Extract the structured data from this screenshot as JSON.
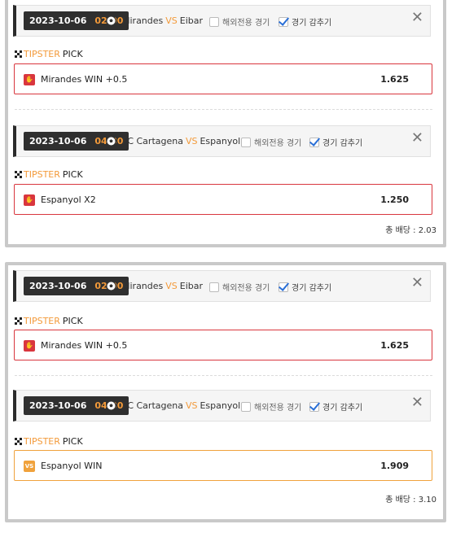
{
  "tipster": {
    "word1": "TIPSTER",
    "word2": "PICK"
  },
  "cards": [
    {
      "matches": [
        {
          "date": "2023-10-06",
          "time": "02:00",
          "home": "Mirandes",
          "vs": "VS",
          "away": "Eibar",
          "overseas_label": "해외전용 경기",
          "hide_label": "경기 감추기",
          "pick_label": "Mirandes WIN +0.5",
          "odds": "1.625",
          "pick_icon": "hand-icon"
        },
        {
          "date": "2023-10-06",
          "time": "04:30",
          "home": "FC Cartagena",
          "vs": "VS",
          "away": "Espanyol",
          "overseas_label": "해외전용 경기",
          "hide_label": "경기 감추기",
          "pick_label": "Espanyol X2",
          "odds": "1.250",
          "pick_icon": "hand-icon"
        }
      ],
      "total": "총 배당 : 2.03"
    },
    {
      "matches": [
        {
          "date": "2023-10-06",
          "time": "02:00",
          "home": "Mirandes",
          "vs": "VS",
          "away": "Eibar",
          "overseas_label": "해외전용 경기",
          "hide_label": "경기 감추기",
          "pick_label": "Mirandes WIN +0.5",
          "odds": "1.625",
          "pick_icon": "hand-icon"
        },
        {
          "date": "2023-10-06",
          "time": "04:30",
          "home": "FC Cartagena",
          "vs": "VS",
          "away": "Espanyol",
          "overseas_label": "해외전용 경기",
          "hide_label": "경기 감추기",
          "pick_label": "Espanyol WIN",
          "odds": "1.909",
          "pick_icon": "vs-icon",
          "pick_icon_text": "VS"
        }
      ],
      "total": "총 배당 : 3.10"
    }
  ],
  "colors": {
    "accent": "#f39a3a",
    "loss_border": "#d9363e",
    "win_border": "#f0a23c",
    "date_bg": "#2f2f2f"
  }
}
